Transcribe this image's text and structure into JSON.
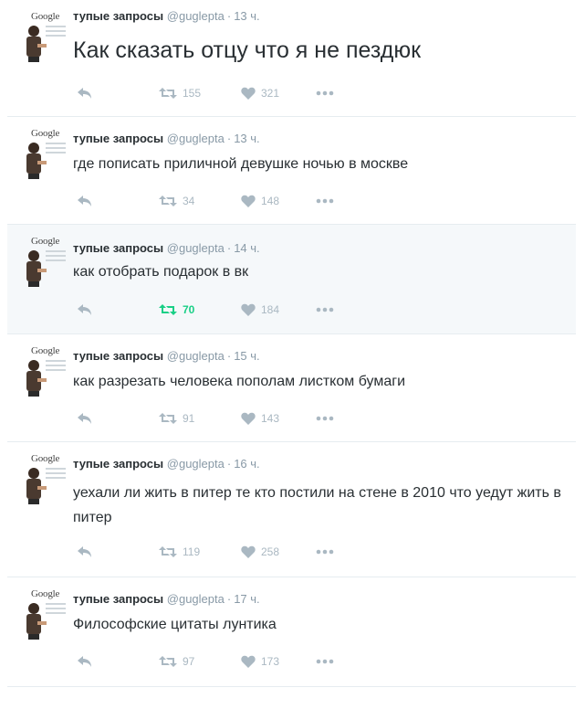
{
  "account": {
    "name": "тупые запросы",
    "handle": "@guglepta",
    "avatar_logo": "Google"
  },
  "tweets": [
    {
      "time": "13 ч.",
      "text": "Как сказать отцу что я не пездюк",
      "retweets": "155",
      "likes": "321"
    },
    {
      "time": "13 ч.",
      "text": "где пописать приличной девушке ночью в москве",
      "retweets": "34",
      "likes": "148"
    },
    {
      "time": "14 ч.",
      "text": "как отобрать подарок в вк",
      "retweets": "70",
      "likes": "184"
    },
    {
      "time": "15 ч.",
      "text": "как разрезать человека пополам листком бумаги",
      "retweets": "91",
      "likes": "143"
    },
    {
      "time": "16 ч.",
      "text": "уехали ли жить в питер те кто постили на стене в 2010 что уедут жить в питер",
      "retweets": "119",
      "likes": "258"
    },
    {
      "time": "17 ч.",
      "text": "Философские цитаты лунтика",
      "retweets": "97",
      "likes": "173"
    }
  ],
  "colors": {
    "retweet_active": "#19cf86",
    "icon_idle": "#aab8c2",
    "highlight_bg": "#f5f8fa"
  },
  "icons": {
    "reply": "reply-icon",
    "retweet": "retweet-icon",
    "like": "heart-icon",
    "more": "more-icon"
  }
}
